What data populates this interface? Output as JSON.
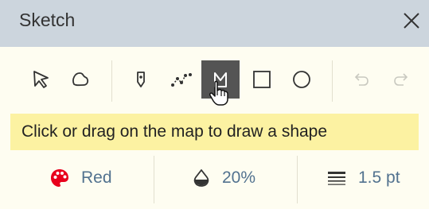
{
  "window": {
    "title": "Sketch",
    "close_icon": "close-icon"
  },
  "toolbar": {
    "tools": [
      {
        "name": "select-tool",
        "icon": "cursor-arrow-icon",
        "active": false
      },
      {
        "name": "lasso-tool",
        "icon": "lasso-icon",
        "active": false
      },
      {
        "name": "point-tool",
        "icon": "map-pin-icon",
        "active": false
      },
      {
        "name": "polyline-tool",
        "icon": "polyline-icon",
        "active": false
      },
      {
        "name": "polygon-tool",
        "icon": "polygon-icon",
        "active": true
      },
      {
        "name": "rectangle-tool",
        "icon": "rectangle-icon",
        "active": false
      },
      {
        "name": "circle-tool",
        "icon": "circle-icon",
        "active": false
      },
      {
        "name": "undo-button",
        "icon": "undo-icon",
        "enabled": false
      },
      {
        "name": "redo-button",
        "icon": "redo-icon",
        "enabled": false
      }
    ]
  },
  "hint": {
    "text": "Click or drag on the map to draw a shape"
  },
  "properties": {
    "color": {
      "icon": "palette-icon",
      "label": "Red",
      "swatch": "#e8001c"
    },
    "opacity": {
      "icon": "opacity-drop-icon",
      "label": "20%"
    },
    "line_width": {
      "icon": "line-weight-icon",
      "label": "1.5 pt"
    }
  },
  "colors": {
    "title_bar": "#ccd5dd",
    "panel_bg": "#fefdf1",
    "hint_bg": "#fcf2a2",
    "active_tool_bg": "#545454",
    "property_text": "#52728f"
  }
}
